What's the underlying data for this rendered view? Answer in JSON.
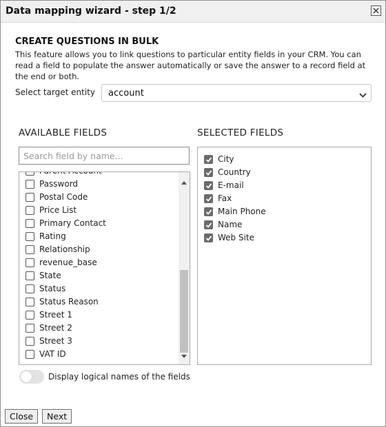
{
  "window": {
    "title": "Data mapping wizard - step 1/2",
    "close_icon": "close-icon"
  },
  "intro": {
    "heading": "CREATE QUESTIONS IN BULK",
    "description": "This feature allows you to link questions to particular entity fields in your CRM. You can read a field to populate the answer automatically or save the answer to a record field at the end or both."
  },
  "entity": {
    "label": "Select target entity",
    "value": "account"
  },
  "available": {
    "title": "AVAILABLE FIELDS",
    "search_placeholder": "Search field by name...",
    "scroll_position": 0.78,
    "items": [
      {
        "label": "Parent Account",
        "checked": false
      },
      {
        "label": "Password",
        "checked": false
      },
      {
        "label": "Postal Code",
        "checked": false
      },
      {
        "label": "Price List",
        "checked": false
      },
      {
        "label": "Primary Contact",
        "checked": false
      },
      {
        "label": "Rating",
        "checked": false
      },
      {
        "label": "Relationship",
        "checked": false
      },
      {
        "label": "revenue_base",
        "checked": false
      },
      {
        "label": "State",
        "checked": false
      },
      {
        "label": "Status",
        "checked": false
      },
      {
        "label": "Status Reason",
        "checked": false
      },
      {
        "label": "Street 1",
        "checked": false
      },
      {
        "label": "Street 2",
        "checked": false
      },
      {
        "label": "Street 3",
        "checked": false
      },
      {
        "label": "VAT ID",
        "checked": false
      }
    ]
  },
  "selected": {
    "title": "SELECTED FIELDS",
    "items": [
      {
        "label": "City",
        "checked": true
      },
      {
        "label": "Country",
        "checked": true
      },
      {
        "label": "E-mail",
        "checked": true
      },
      {
        "label": "Fax",
        "checked": true
      },
      {
        "label": "Main Phone",
        "checked": true
      },
      {
        "label": "Name",
        "checked": true
      },
      {
        "label": "Web Site",
        "checked": true
      }
    ]
  },
  "toggle": {
    "label": "Display logical names of the fields",
    "on": false
  },
  "buttons": {
    "close": "Close",
    "next": "Next"
  }
}
